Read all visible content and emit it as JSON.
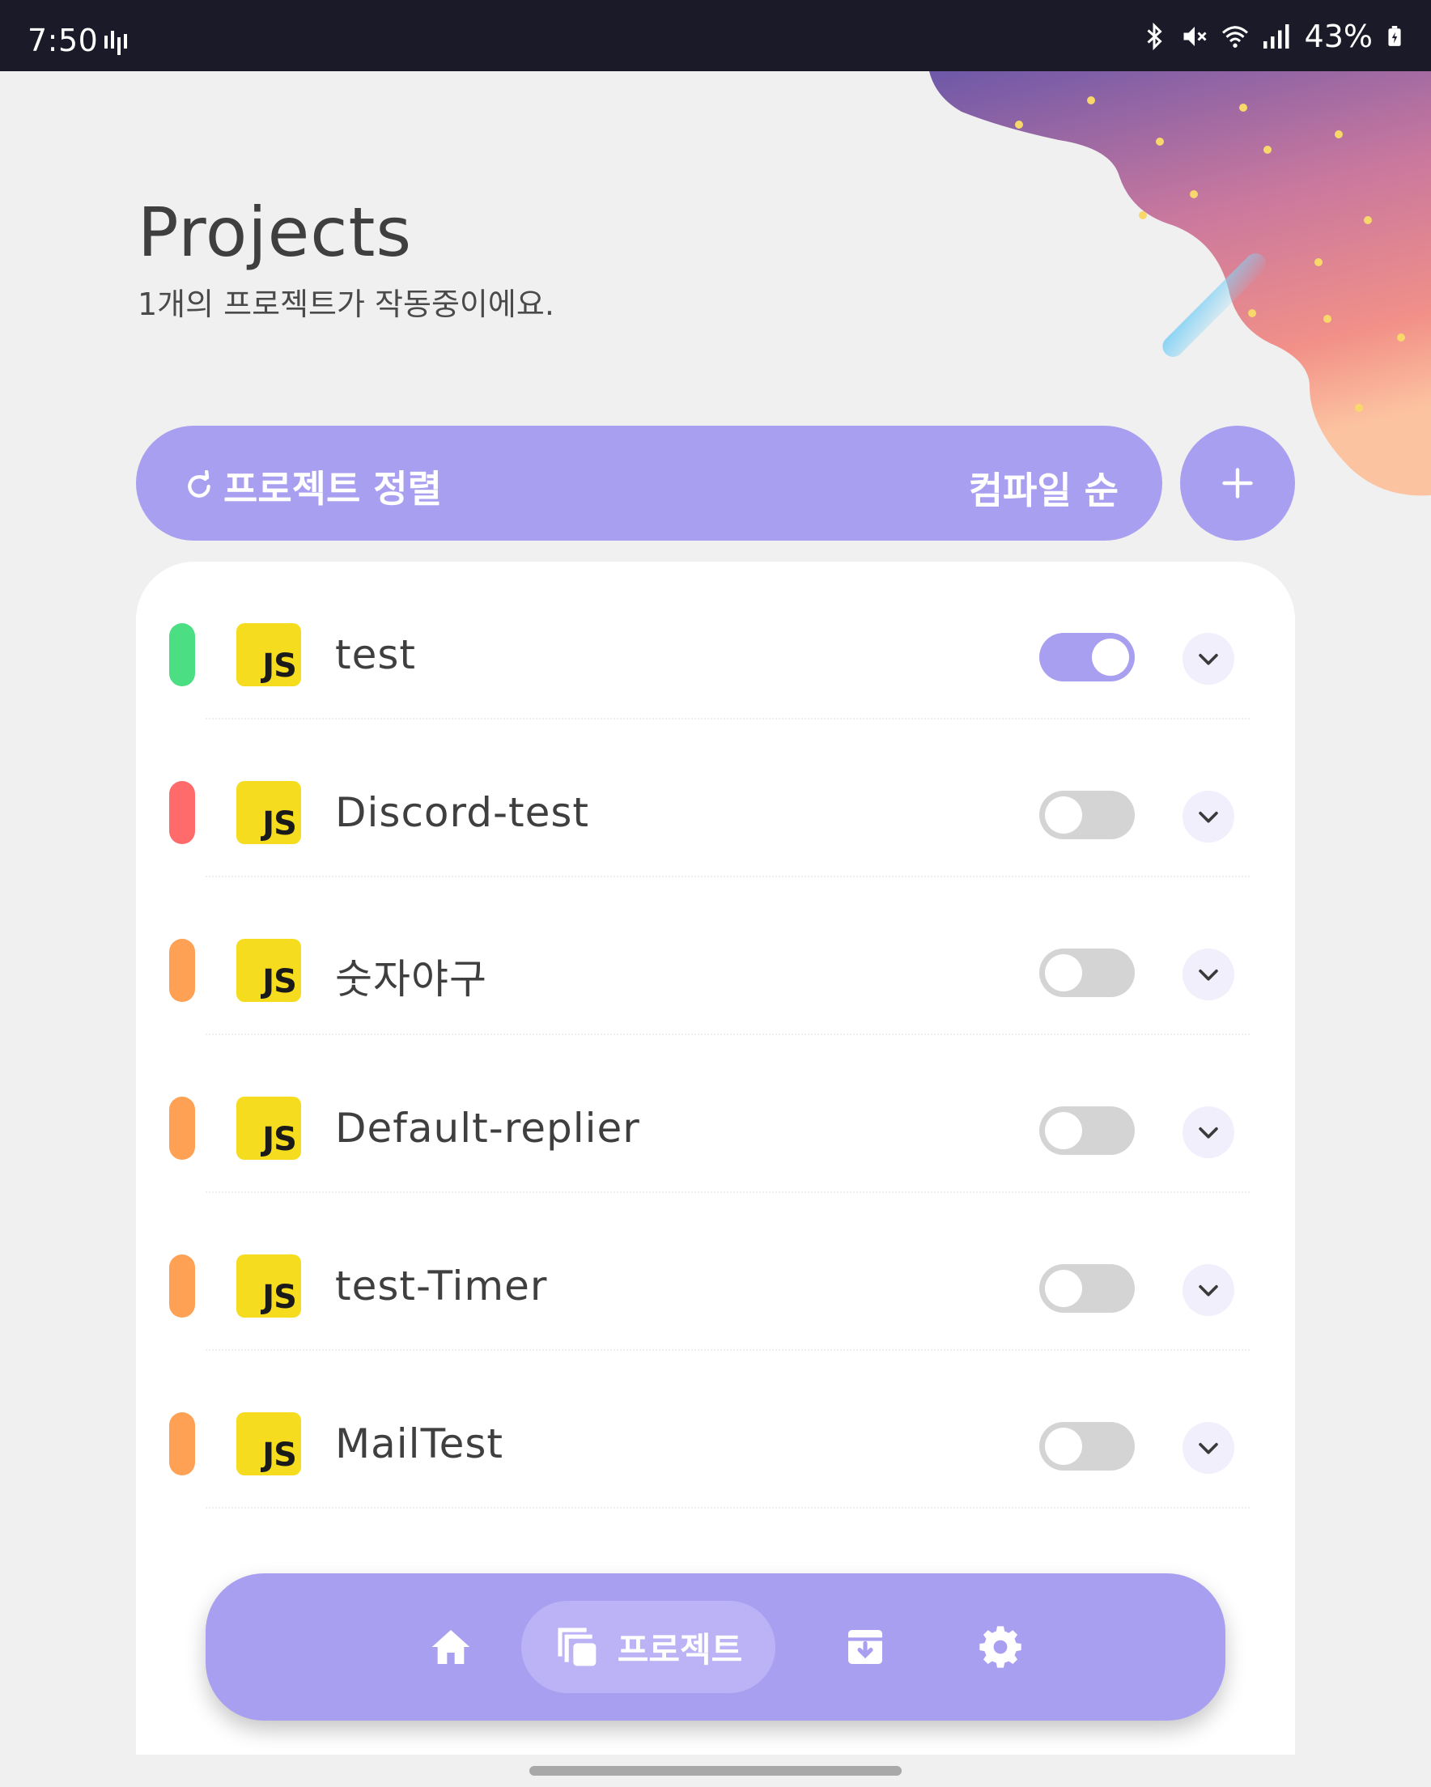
{
  "status_bar": {
    "time": "7:50",
    "battery_percent": "43%"
  },
  "header": {
    "title": "Projects",
    "subtitle": "1개의 프로젝트가 작동중이에요."
  },
  "sort_bar": {
    "label": "프로젝트 정렬",
    "mode": "컴파일 순"
  },
  "projects": [
    {
      "name": "test",
      "language": "JS",
      "status_color": "#4cde82",
      "enabled": true
    },
    {
      "name": "Discord-test",
      "language": "JS",
      "status_color": "#ff6b6b",
      "enabled": false
    },
    {
      "name": "숫자야구",
      "language": "JS",
      "status_color": "#ffa155",
      "enabled": false
    },
    {
      "name": "Default-replier",
      "language": "JS",
      "status_color": "#ffa155",
      "enabled": false
    },
    {
      "name": "test-Timer",
      "language": "JS",
      "status_color": "#ffa155",
      "enabled": false
    },
    {
      "name": "MailTest",
      "language": "JS",
      "status_color": "#ffa155",
      "enabled": false
    }
  ],
  "bottom_nav": {
    "active_label": "프로젝트",
    "items": [
      "home-icon",
      "projects-icon",
      "archive-icon",
      "settings-icon"
    ]
  },
  "colors": {
    "accent": "#a99ff0",
    "js_badge": "#f5dc1e",
    "background": "#f0f0f0"
  }
}
